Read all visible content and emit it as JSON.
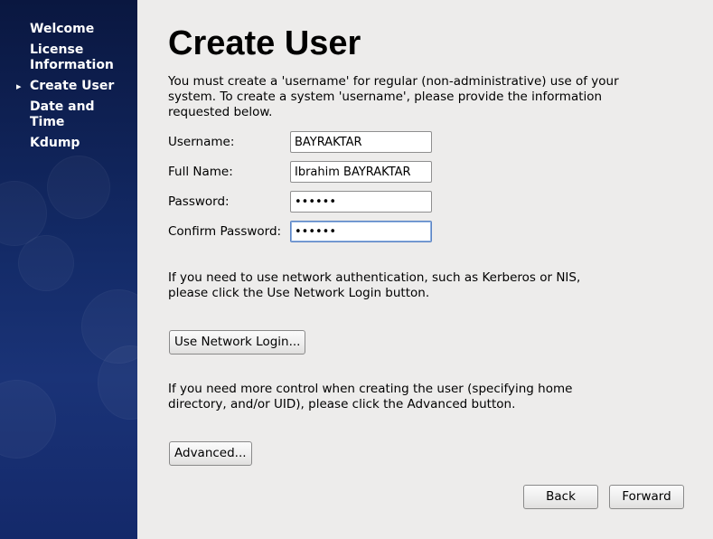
{
  "sidebar": {
    "items": [
      {
        "label": "Welcome",
        "current": false
      },
      {
        "label": "License Information",
        "current": false
      },
      {
        "label": "Create User",
        "current": true
      },
      {
        "label": "Date and Time",
        "current": false
      },
      {
        "label": "Kdump",
        "current": false
      }
    ],
    "current_marker": "▸"
  },
  "main": {
    "title": "Create User",
    "intro_text": "You must create a 'username' for regular (non-administrative) use of your system.  To create a system 'username', please provide the information requested below.",
    "form": {
      "username": {
        "label": "Username:",
        "value": "BAYRAKTAR"
      },
      "full_name": {
        "label": "Full Name:",
        "value": "İbrahim BAYRAKTAR"
      },
      "password": {
        "label": "Password:",
        "value": "••••••"
      },
      "confirm_password": {
        "label": "Confirm Password:",
        "value": "••••••"
      }
    },
    "network_text": "If you need to use network authentication, such as Kerberos or NIS, please click the Use Network Login button.",
    "network_button_label": "Use Network Login...",
    "advanced_text": "If you need more control when creating the user (specifying home directory, and/or UID), please click the Advanced button.",
    "advanced_button_label": "Advanced..."
  },
  "footer": {
    "back_label": "Back",
    "forward_label": "Forward"
  },
  "colors": {
    "sidebar_bg": "#132a66",
    "content_bg": "#edeceb",
    "focus_border": "#5b84c4"
  }
}
